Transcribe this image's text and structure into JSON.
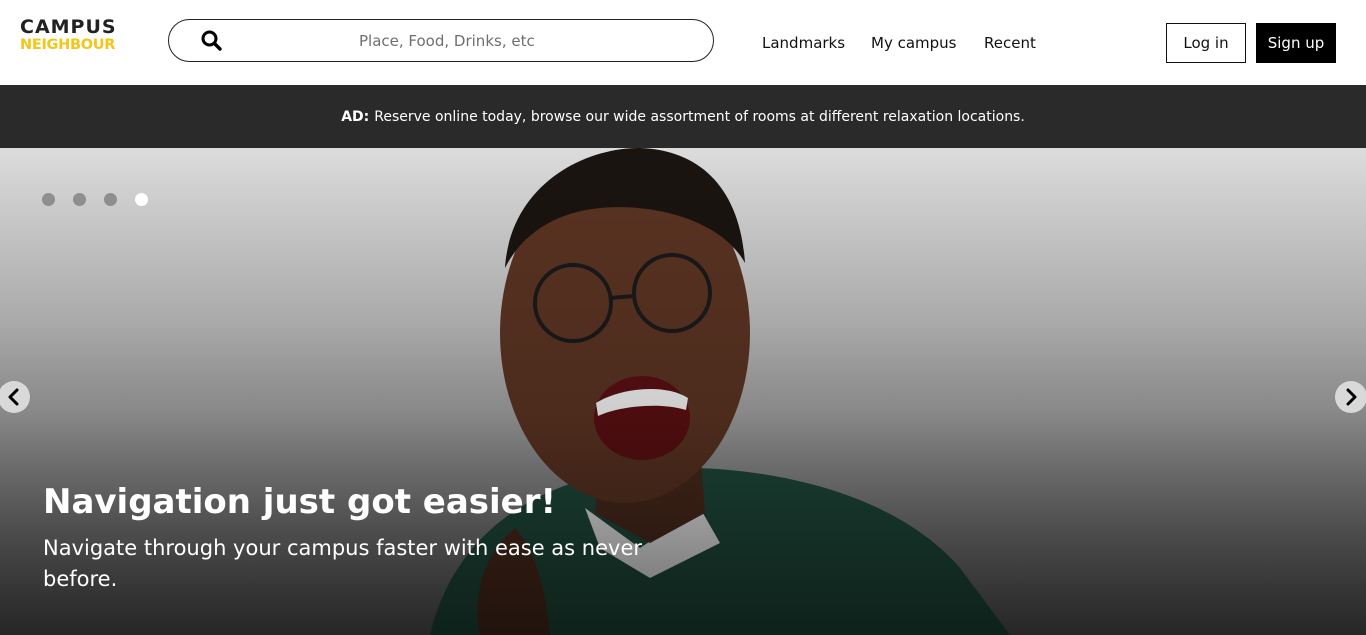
{
  "logo": {
    "line1": "CAMPUS",
    "line2": "NEIGHBOUR",
    "accent_color": "#f5c518"
  },
  "search": {
    "placeholder": "Place, Food, Drinks, etc",
    "value": "",
    "icon": "search-icon"
  },
  "nav": {
    "items": [
      {
        "label": "Landmarks"
      },
      {
        "label": "My campus"
      },
      {
        "label": "Recent"
      }
    ]
  },
  "auth": {
    "login_label": "Log in",
    "signup_label": "Sign up"
  },
  "ad": {
    "prefix": "AD:",
    "text": "Reserve online today, browse our wide assortment of rooms at different relaxation locations."
  },
  "hero": {
    "title": "Navigation just got easier!",
    "subtitle": "Navigate through your campus faster with ease as never before.",
    "slide_count": 4,
    "active_slide": 4,
    "prev_icon": "chevron-left-icon",
    "next_icon": "chevron-right-icon"
  }
}
